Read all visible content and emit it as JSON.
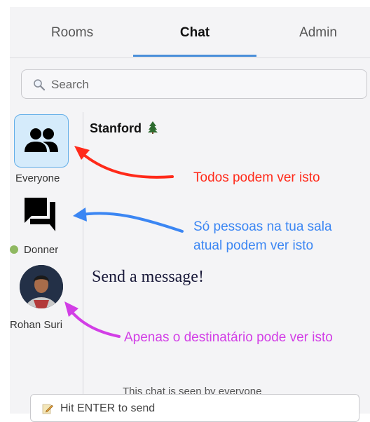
{
  "tabs": [
    {
      "label": "Rooms"
    },
    {
      "label": "Chat",
      "active": true
    },
    {
      "label": "Admin"
    }
  ],
  "search": {
    "placeholder": "Search"
  },
  "sidebar": {
    "items": [
      {
        "label": "Everyone",
        "icon": "people-icon"
      },
      {
        "label": "Donner",
        "icon": "chat-bubbles-icon",
        "badge_icon": "tree-icon"
      },
      {
        "label": "Rohan Suri",
        "icon": "avatar"
      }
    ]
  },
  "main": {
    "room_title": "Stanford",
    "room_icon": "pine-tree-icon",
    "empty_message": "Send a message!",
    "visibility_note": "This chat is seen by everyone"
  },
  "composer": {
    "placeholder": "Hit ENTER to send"
  },
  "annotations": {
    "everyone": "Todos podem ver isto",
    "room_line1": "Só pessoas na tua sala",
    "room_line2": "atual podem ver isto",
    "dm": "Apenas o destinatário pode ver isto"
  },
  "colors": {
    "accent": "#4a8fd9",
    "annotation_red": "#ff2a1a",
    "annotation_blue": "#3b86f3",
    "annotation_magenta": "#d23ee6",
    "selected_room_bg": "#d5ebfb"
  }
}
